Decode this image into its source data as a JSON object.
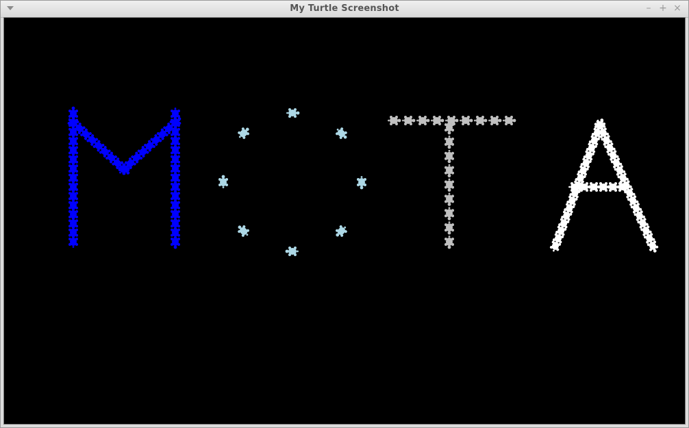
{
  "window": {
    "title": "My Turtle Screenshot",
    "buttons": {
      "minimize": "–",
      "maximize": "+",
      "close": "×"
    }
  },
  "canvas": {
    "background": "#000000",
    "letters": [
      {
        "glyph": "M",
        "color": "#0000ff",
        "style": "turtle-shapes-dense"
      },
      {
        "glyph": "O",
        "color": "#add8e6",
        "style": "turtle-shapes-circle"
      },
      {
        "glyph": "T",
        "color": "#c0c0c0",
        "style": "turtle-shapes-dense"
      },
      {
        "glyph": "A",
        "color": "#ffffff",
        "style": "turtle-shapes-dense"
      }
    ]
  }
}
